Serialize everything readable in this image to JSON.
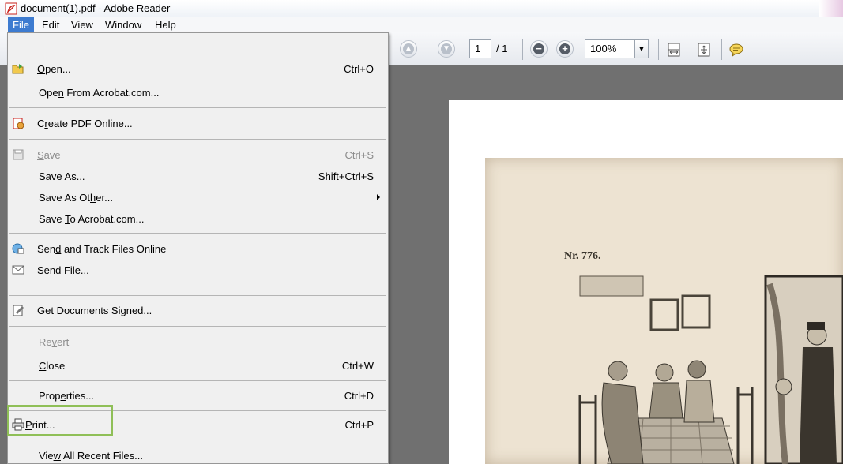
{
  "window": {
    "title": "document(1).pdf - Adobe Reader"
  },
  "menubar": {
    "items": [
      "File",
      "Edit",
      "View",
      "Window",
      "Help"
    ],
    "active": "File"
  },
  "toolbar": {
    "page_current": "1",
    "page_total": "/ 1",
    "zoom": "100%",
    "icons": [
      "prev-page-icon",
      "next-page-icon",
      "zoom-out-icon",
      "zoom-in-icon",
      "fit-width-icon",
      "fit-page-icon",
      "comment-icon"
    ]
  },
  "file_menu": {
    "items": [
      {
        "label": "Open...",
        "mnemonic": "O",
        "shortcut": "Ctrl+O",
        "icon": "open-folder-icon"
      },
      {
        "label": "Open From Acrobat.com...",
        "mnemonic": "n",
        "shortcut": ""
      },
      {
        "label": "Create PDF Online...",
        "mnemonic": "r",
        "shortcut": "",
        "icon": "create-pdf-icon"
      },
      {
        "label": "Save",
        "mnemonic": "S",
        "shortcut": "Ctrl+S",
        "icon": "save-icon",
        "disabled": true
      },
      {
        "label": "Save As...",
        "mnemonic": "A",
        "shortcut": "Shift+Ctrl+S"
      },
      {
        "label": "Save As Other...",
        "mnemonic": "h",
        "shortcut": "",
        "submenu": true
      },
      {
        "label": "Save To Acrobat.com...",
        "mnemonic": "T",
        "shortcut": ""
      },
      {
        "label": "Send and Track Files Online",
        "mnemonic": "d",
        "shortcut": "",
        "icon": "send-track-icon"
      },
      {
        "label": "Send File...",
        "mnemonic": "l",
        "shortcut": "",
        "icon": "envelope-icon"
      },
      {
        "label": "Get Documents Signed...",
        "shortcut": "",
        "icon": "sign-document-icon"
      },
      {
        "label": "Revert",
        "mnemonic": "v",
        "shortcut": "",
        "disabled": true
      },
      {
        "label": "Close",
        "mnemonic": "C",
        "shortcut": "Ctrl+W"
      },
      {
        "label": "Properties...",
        "mnemonic": "e",
        "shortcut": "Ctrl+D"
      },
      {
        "label": "Print...",
        "mnemonic": "P",
        "shortcut": "Ctrl+P",
        "icon": "printer-icon",
        "highlighted": true
      },
      {
        "label": "View All Recent Files...",
        "mnemonic": "w",
        "shortcut": ""
      }
    ]
  },
  "document": {
    "text": "Nr. 776."
  },
  "colors": {
    "menu_active": "#3d7bd0",
    "highlight_border": "#8fbf57",
    "doc_background": "#707070"
  }
}
